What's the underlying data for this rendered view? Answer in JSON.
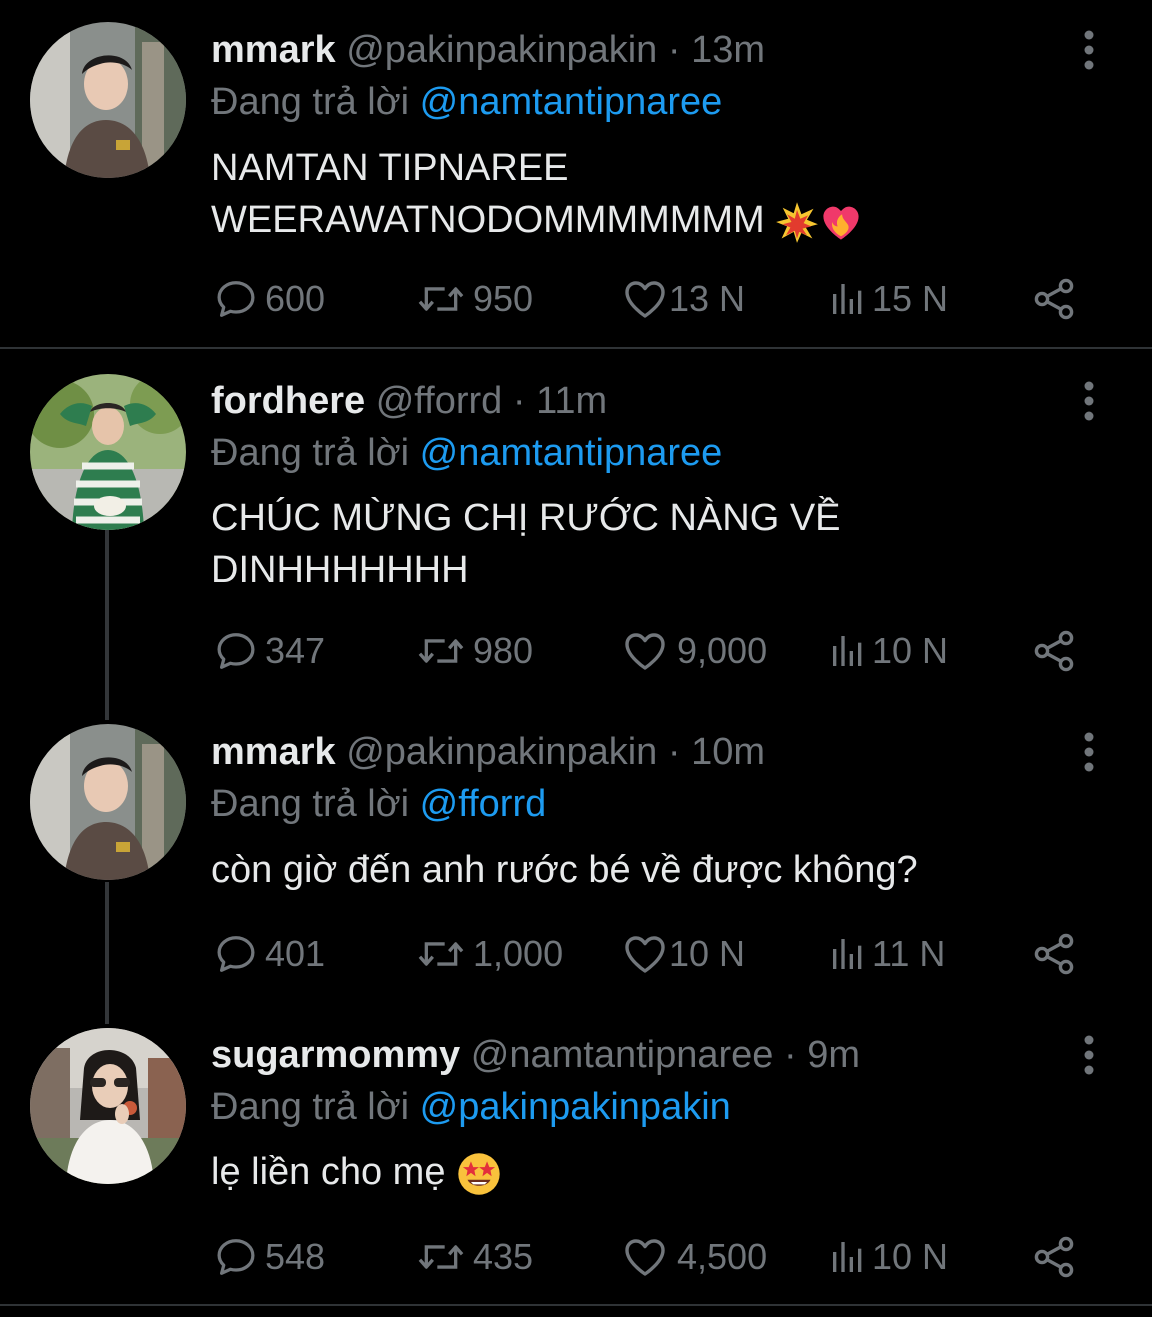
{
  "tweets": [
    {
      "name": "mmark",
      "handle": "@pakinpakinpakin",
      "sep": " · ",
      "time": "13m",
      "reply_prefix": "Đang trả lời ",
      "reply_to": "@namtantipnaree",
      "body_line1": "NAMTAN TIPNAREE",
      "body_line2": "WEERAWATNODOMMMMMMM",
      "body_emojis": [
        "collision-emoji",
        "heart-on-fire-emoji"
      ],
      "replies": "600",
      "retweets": "950",
      "likes": "13 N",
      "views": "15 N"
    },
    {
      "name": "fordhere",
      "handle": "@fforrd",
      "sep": " · ",
      "time": "11m",
      "reply_prefix": "Đang trả lời ",
      "reply_to": "@namtantipnaree",
      "body_line1": "CHÚC MỪNG CHỊ RƯỚC NÀNG VỀ",
      "body_line2": "DINHHHHHHH",
      "replies": "347",
      "retweets": "980",
      "likes": "9,000",
      "views": "10 N"
    },
    {
      "name": "mmark",
      "handle": "@pakinpakinpakin",
      "sep": " · ",
      "time": "10m",
      "reply_prefix": "Đang trả lời ",
      "reply_to": "@fforrd",
      "body_line1": "còn giờ đến anh rước bé về được không?",
      "replies": "401",
      "retweets": "1,000",
      "likes": "10 N",
      "views": "11 N"
    },
    {
      "name": "sugarmommy",
      "handle": "@namtantipnaree",
      "sep": " · ",
      "time": "9m",
      "reply_prefix": "Đang trả lời ",
      "reply_to": "@pakinpakinpakin",
      "body_line1": "lẹ liền cho mẹ",
      "body_emojis": [
        "star-struck-emoji"
      ],
      "replies": "548",
      "retweets": "435",
      "likes": "4,500",
      "views": "10 N"
    }
  ],
  "colors": {
    "background": "#000000",
    "text": "#e7e9ea",
    "secondary": "#71767b",
    "accent": "#1d9bf0",
    "divider": "#2f3336"
  },
  "icons": [
    "reply-icon",
    "retweet-icon",
    "like-icon",
    "views-icon",
    "share-icon",
    "more-icon"
  ]
}
